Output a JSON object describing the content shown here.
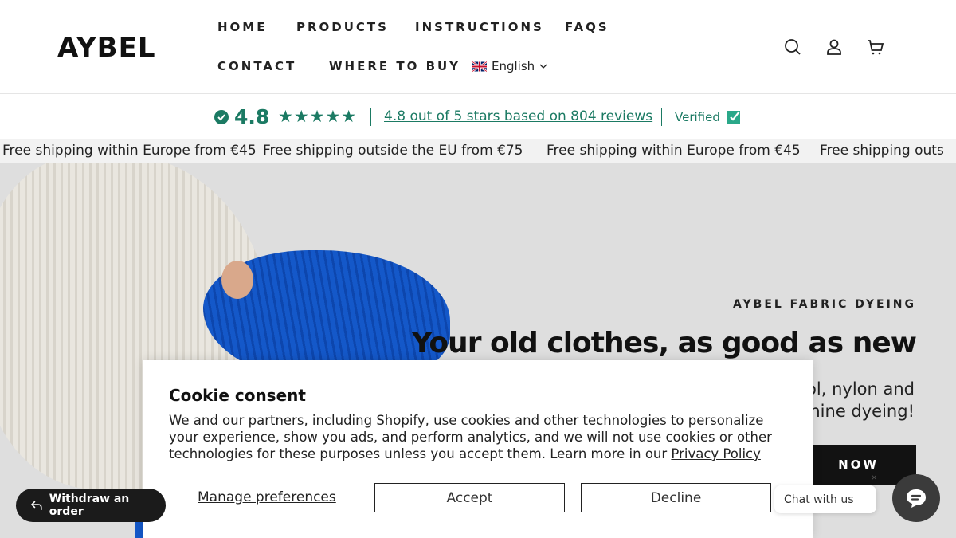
{
  "header": {
    "logo": "AYBEL",
    "nav": {
      "home": "HOME",
      "products": "PRODUCTS",
      "instructions": "INSTRUCTIONS",
      "faqs": "FAQS",
      "contact": "CONTACT",
      "where_to_buy": "WHERE TO BUY"
    },
    "language": "English",
    "icons": [
      "search-icon",
      "account-icon",
      "cart-icon"
    ]
  },
  "reviews": {
    "rating": "4.8",
    "stars": "★★★★★",
    "summary": "4.8 out of 5 stars based on 804 reviews",
    "verified": "Verified"
  },
  "announcement": {
    "items": [
      "Free shipping within Europe from €45 ",
      " Free shipping outside the EU from €75 ",
      " Free shipping within Europe from €45 ",
      " Free shipping outs"
    ]
  },
  "hero": {
    "kicker": "AYBEL FABRIC DYEING",
    "title": "Your old clothes, as good as new",
    "subtitle": "ol, nylon and\nhine dyeing!",
    "button": "NOW"
  },
  "cookie": {
    "title": "Cookie consent",
    "text": "We and our partners, including Shopify, use cookies and other technologies to personalize your experience, show you ads, and perform analytics, and we will not use cookies or other technologies for these purposes unless you accept them. Learn more in our ",
    "policy_link": "Privacy Policy",
    "manage": "Manage preferences",
    "accept": "Accept",
    "decline": "Decline"
  },
  "widgets": {
    "withdraw": "Withdraw an order",
    "chat": "Chat with us ",
    "chat_close": "×"
  },
  "colors": {
    "accent_green": "#1b7a63",
    "dark": "#121212",
    "hero_bg": "#dedede"
  }
}
